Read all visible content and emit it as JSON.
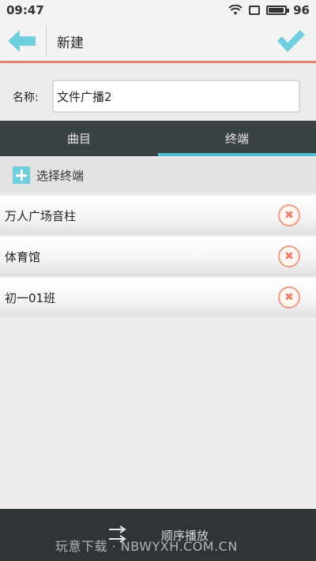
{
  "status_bar": {
    "time": "09:47",
    "battery_level": "96"
  },
  "header": {
    "title": "新建",
    "back_icon": "arrow-left-icon",
    "confirm_icon": "checkmark-icon"
  },
  "form": {
    "name_label": "名称:",
    "name_value": "文件广播2"
  },
  "tabs": [
    {
      "label": "曲目",
      "active": false
    },
    {
      "label": "终端",
      "active": true
    }
  ],
  "select_terminal": {
    "label": "选择终端",
    "icon": "plus-icon"
  },
  "terminals": [
    {
      "name": "万人广场音柱"
    },
    {
      "name": "体育馆"
    },
    {
      "name": "初一01班"
    }
  ],
  "bottom_bar": {
    "play_mode_label": "顺序播放",
    "play_mode_icon": "sequential-play-icon"
  },
  "watermark": "玩意下载 · NBWYXH.COM.CN",
  "colors": {
    "accent": "#4fc3d4",
    "remove": "#e8826c",
    "tab_bar": "#3a4245",
    "bottom_bar": "#2f3437"
  }
}
